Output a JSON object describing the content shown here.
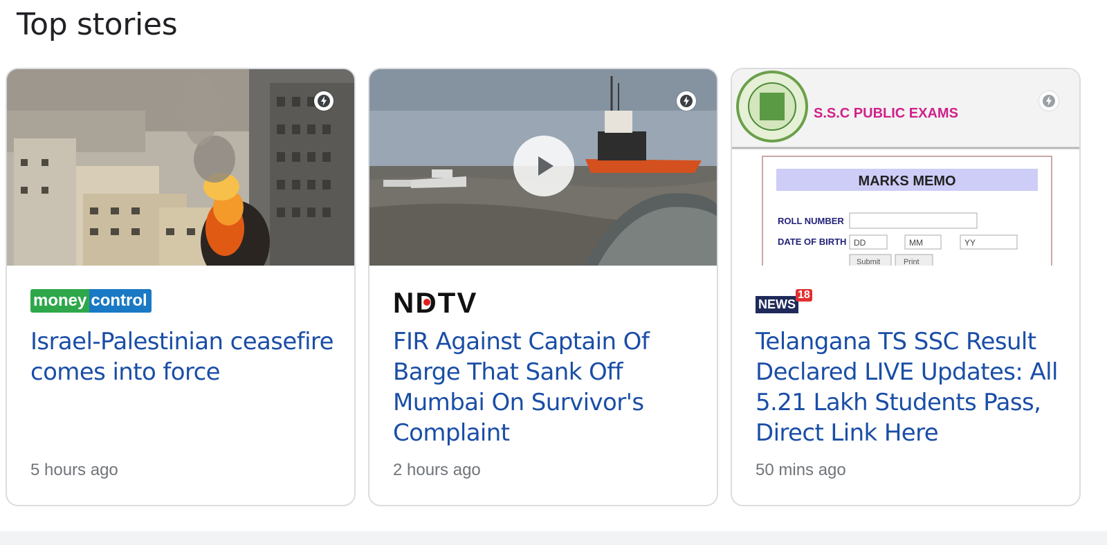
{
  "section": {
    "title": "Top stories"
  },
  "stories": [
    {
      "source": "moneycontrol",
      "source_parts": [
        "money",
        "control"
      ],
      "headline": "Israel-Palestinian ceasefire comes into force",
      "time": "5 hours ago",
      "thumbnail": "city-explosion-image",
      "amp": true,
      "video": false
    },
    {
      "source": "NDTV",
      "headline": "FIR Against Captain Of Barge That Sank Off Mumbai On Survivor's Complaint",
      "time": "2 hours ago",
      "thumbnail": "sea-ships-video-thumbnail",
      "amp": true,
      "video": true
    },
    {
      "source": "NEWS18",
      "source_parts": [
        "NEWS",
        "18"
      ],
      "headline": "Telangana TS SSC Result Declared LIVE Updates: All 5.21 Lakh Students Pass, Direct Link Here",
      "time": "50 mins ago",
      "thumbnail": "ssc-marks-memo-form",
      "thumbnail_text": {
        "banner": "S.S.C PUBLIC EXAMS",
        "memo_title": "MARKS MEMO",
        "roll_label": "ROLL NUMBER",
        "dob_label": "DATE OF BIRTH",
        "dd": "DD",
        "mm": "MM",
        "yy": "YY",
        "submit": "Submit",
        "print": "Print"
      },
      "amp": true,
      "video": false
    }
  ],
  "colors": {
    "headline": "#1a4ea6",
    "timestamp": "#70757a",
    "border": "#dadce0",
    "moneycontrol_green": "#2da74a",
    "moneycontrol_blue": "#1a79c4"
  }
}
